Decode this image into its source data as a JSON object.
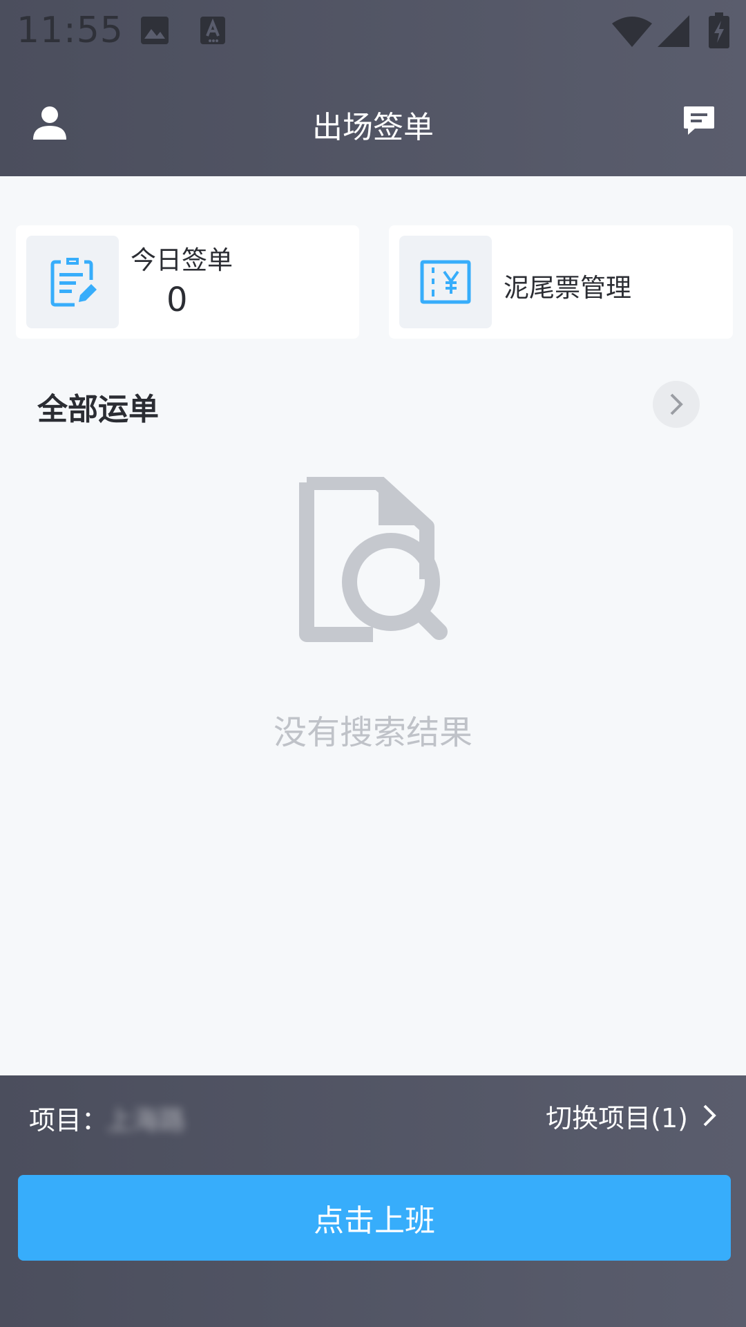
{
  "status_bar": {
    "time": "11:55"
  },
  "header": {
    "title": "出场签单"
  },
  "cards": {
    "today": {
      "label": "今日签单",
      "count": "0"
    },
    "mud": {
      "label": "泥尾票管理"
    }
  },
  "section": {
    "title": "全部运单"
  },
  "empty": {
    "text": "没有搜索结果"
  },
  "footer": {
    "project_label": "项目：",
    "project_value": "上海路",
    "switch_label": "切换项目(1)",
    "clockin_label": "点击上班"
  },
  "colors": {
    "header_bg": "#4b4e5d",
    "accent": "#37adfb",
    "page_bg": "#f6f8fa",
    "empty_gray": "#c5c8ce"
  }
}
